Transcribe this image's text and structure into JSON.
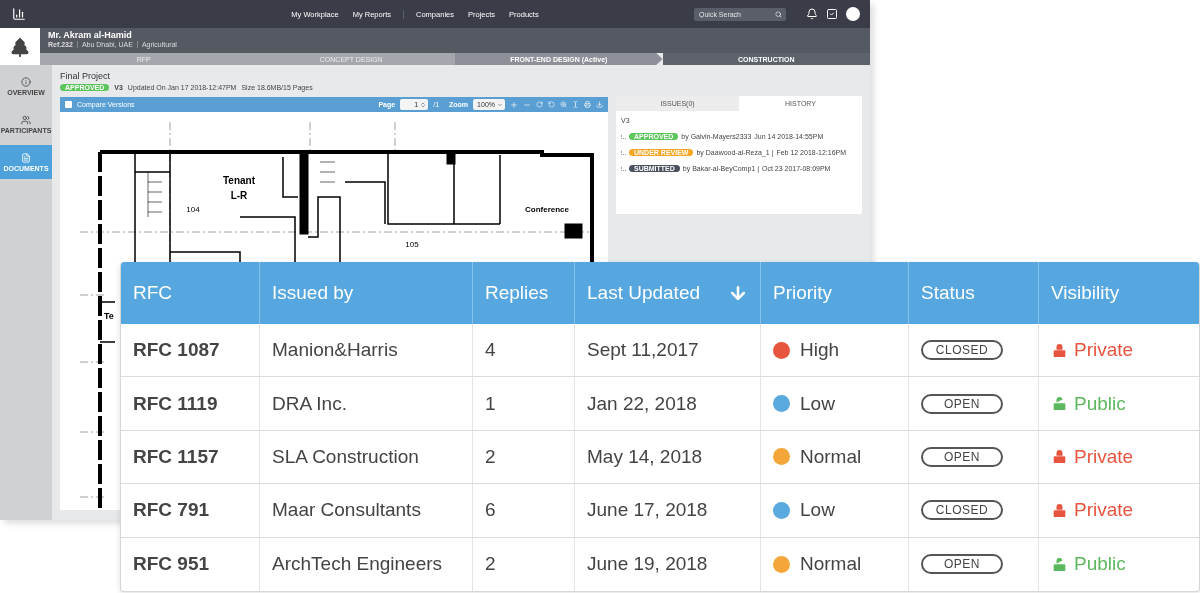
{
  "topbar": {
    "nav_groups": [
      [
        {
          "label": "My Workplace"
        },
        {
          "label": "My Reports"
        }
      ],
      [
        {
          "label": "Companies"
        },
        {
          "label": "Projects"
        },
        {
          "label": "Products"
        }
      ]
    ],
    "search": {
      "placeholder": "Quick Serach"
    }
  },
  "client": {
    "name": "Mr. Akram al-Hamid",
    "ref": "Ref.232",
    "location": "Abu Dhabi, UAE",
    "sector": "Agricultural"
  },
  "stages": [
    {
      "label": "RFP",
      "completed": true,
      "active": false
    },
    {
      "label": "CONCEPT DESIGN",
      "completed": true,
      "active": false
    },
    {
      "label": "FRONT-END DESIGN (Active)",
      "completed": false,
      "active": true
    },
    {
      "label": "CONSTRUCTION",
      "completed": false,
      "active": false
    }
  ],
  "sidebar": {
    "items": [
      {
        "label": "OVERVIEW",
        "kind": "info",
        "selected": false
      },
      {
        "label": "PARTICIPANTS",
        "kind": "people",
        "selected": false
      },
      {
        "label": "DOCUMENTS",
        "kind": "document",
        "selected": true
      }
    ]
  },
  "document": {
    "title": "Final Project",
    "status": "APPROVED",
    "version": "V3",
    "updated": "Updated On Jan 17 2018-12:47PM",
    "size": "Size 18.6MB/15 Pages"
  },
  "viewer": {
    "compare": {
      "label": "Compare Versions",
      "checked": false
    },
    "page_label": "Page",
    "page": "1",
    "page_total": "/1",
    "zoom_label": "Zoom",
    "zoom": "100%",
    "plan_labels": [
      {
        "kind": "big",
        "text": "Tenant"
      },
      {
        "kind": "big",
        "text": "L-R"
      },
      {
        "kind": "room",
        "text": "Conference"
      },
      {
        "kind": "tag",
        "text": "104"
      },
      {
        "kind": "tag",
        "text": "105"
      },
      {
        "kind": "edge",
        "text": "Te"
      }
    ]
  },
  "panel": {
    "tabs": [
      {
        "label": "ISSUES(0)",
        "selected": false
      },
      {
        "label": "HISTORY",
        "selected": true
      }
    ],
    "version": "V3",
    "history": [
      {
        "badge": "APPROVED",
        "color": "#5cc55c",
        "by": "by Galvin-Mayers2333",
        "date": "Jun 14 2018-14:55PM"
      },
      {
        "badge": "UNDER REVIEW",
        "color": "#f5a623",
        "by": "by Daawood-al-Reza_1 |",
        "date": "Feb 12 2018-12:16PM"
      },
      {
        "badge": "SUBMITTED",
        "color": "#4a5260",
        "by": "by Bakar-al-BeyComp1 |",
        "date": "Oct 23 2017-08:09PM"
      }
    ]
  },
  "table": {
    "columns": [
      {
        "label": "RFC",
        "sorted": false
      },
      {
        "label": "Issued by",
        "sorted": false
      },
      {
        "label": "Replies",
        "sorted": false
      },
      {
        "label": "Last Updated",
        "sorted": true
      },
      {
        "label": "Priority",
        "sorted": false
      },
      {
        "label": "Status",
        "sorted": false
      },
      {
        "label": "Visibility",
        "sorted": false
      }
    ],
    "rows": [
      {
        "rfc": "RFC 1087",
        "issued_by": "Manion&Harris",
        "replies": "4",
        "last_updated": "Sept 11,2017",
        "priority": "High",
        "color": "#e8553f",
        "status": "CLOSED",
        "visibility": "Private",
        "kind": "private"
      },
      {
        "rfc": "RFC 1119",
        "issued_by": "DRA Inc.",
        "replies": "1",
        "last_updated": "Jan 22, 2018",
        "priority": "Low",
        "color": "#5aa9df",
        "status": "OPEN",
        "visibility": "Public",
        "kind": "public"
      },
      {
        "rfc": "RFC 1157",
        "issued_by": "SLA Construction",
        "replies": "2",
        "last_updated": "May 14, 2018",
        "priority": "Normal",
        "color": "#f5a63a",
        "status": "OPEN",
        "visibility": "Private",
        "kind": "private"
      },
      {
        "rfc": "RFC 791",
        "issued_by": "Maar Consultants",
        "replies": "6",
        "last_updated": "June 17, 2018",
        "priority": "Low",
        "color": "#5aa9df",
        "status": "CLOSED",
        "visibility": "Private",
        "kind": "private"
      },
      {
        "rfc": "RFC 951",
        "issued_by": "ArchTech Engineers",
        "replies": "2",
        "last_updated": "June 19, 2018",
        "priority": "Normal",
        "color": "#f5a63a",
        "status": "OPEN",
        "visibility": "Public",
        "kind": "public"
      }
    ]
  }
}
